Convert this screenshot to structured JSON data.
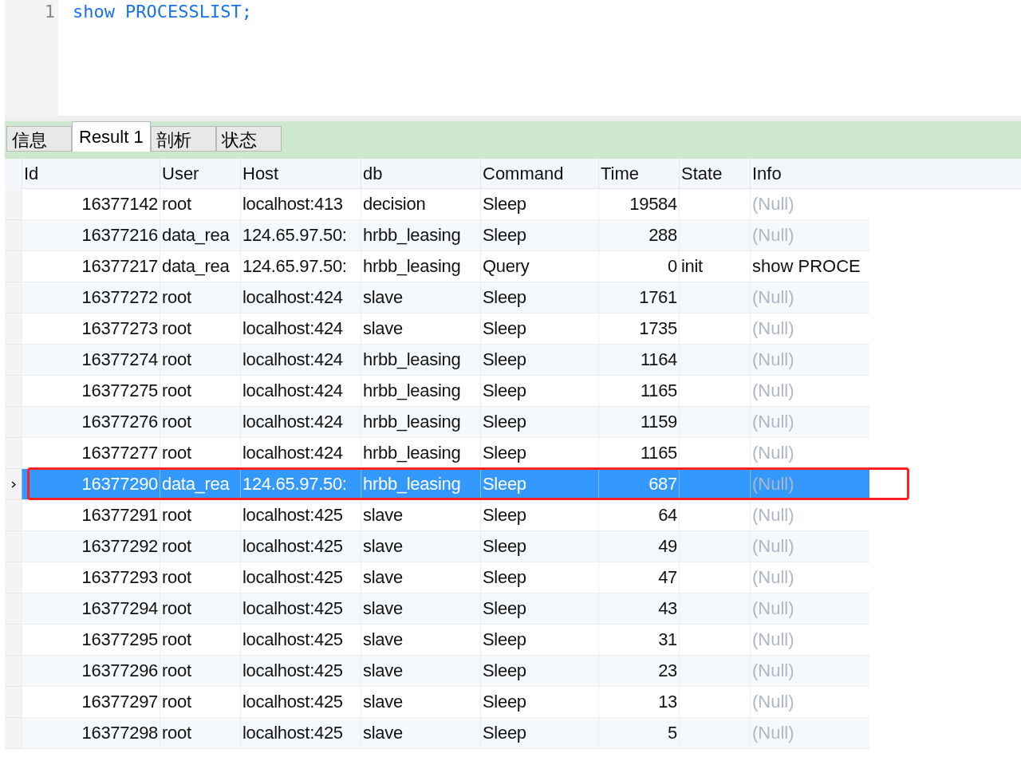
{
  "editor": {
    "lines": [
      {
        "number": "1",
        "keyword": "show",
        "rest": "PROCESSLIST;"
      }
    ]
  },
  "tabs": [
    {
      "label": "信息",
      "selected": false
    },
    {
      "label": "Result 1",
      "selected": true
    },
    {
      "label": "剖析",
      "selected": false
    },
    {
      "label": "状态",
      "selected": false
    }
  ],
  "table": {
    "columns": [
      "Id",
      "User",
      "Host",
      "db",
      "Command",
      "Time",
      "State",
      "Info"
    ],
    "rows": [
      {
        "cells": [
          "16377142",
          "root",
          "localhost:413",
          "decision",
          "Sleep",
          "19584",
          ""
        ],
        "info": "(Null)",
        "info_null": true,
        "selected": false,
        "highlighted": false
      },
      {
        "cells": [
          "16377216",
          "data_rea",
          "124.65.97.50:",
          "hrbb_leasing",
          "Sleep",
          "288",
          ""
        ],
        "info": "(Null)",
        "info_null": true,
        "selected": false,
        "highlighted": false
      },
      {
        "cells": [
          "16377217",
          "data_rea",
          "124.65.97.50:",
          "hrbb_leasing",
          "Query",
          "0",
          "init"
        ],
        "info": "show PROCE",
        "info_null": false,
        "selected": false,
        "highlighted": false
      },
      {
        "cells": [
          "16377272",
          "root",
          "localhost:424",
          "slave",
          "Sleep",
          "1761",
          ""
        ],
        "info": "(Null)",
        "info_null": true,
        "selected": false,
        "highlighted": false
      },
      {
        "cells": [
          "16377273",
          "root",
          "localhost:424",
          "slave",
          "Sleep",
          "1735",
          ""
        ],
        "info": "(Null)",
        "info_null": true,
        "selected": false,
        "highlighted": false
      },
      {
        "cells": [
          "16377274",
          "root",
          "localhost:424",
          "hrbb_leasing",
          "Sleep",
          "1164",
          ""
        ],
        "info": "(Null)",
        "info_null": true,
        "selected": false,
        "highlighted": false
      },
      {
        "cells": [
          "16377275",
          "root",
          "localhost:424",
          "hrbb_leasing",
          "Sleep",
          "1165",
          ""
        ],
        "info": "(Null)",
        "info_null": true,
        "selected": false,
        "highlighted": false
      },
      {
        "cells": [
          "16377276",
          "root",
          "localhost:424",
          "hrbb_leasing",
          "Sleep",
          "1159",
          ""
        ],
        "info": "(Null)",
        "info_null": true,
        "selected": false,
        "highlighted": false
      },
      {
        "cells": [
          "16377277",
          "root",
          "localhost:424",
          "hrbb_leasing",
          "Sleep",
          "1165",
          ""
        ],
        "info": "(Null)",
        "info_null": true,
        "selected": false,
        "highlighted": false
      },
      {
        "cells": [
          "16377290",
          "data_rea",
          "124.65.97.50:",
          "hrbb_leasing",
          "Sleep",
          "687",
          ""
        ],
        "info": "(Null)",
        "info_null": true,
        "selected": true,
        "highlighted": true
      },
      {
        "cells": [
          "16377291",
          "root",
          "localhost:425",
          "slave",
          "Sleep",
          "64",
          ""
        ],
        "info": "(Null)",
        "info_null": true,
        "selected": false,
        "highlighted": false
      },
      {
        "cells": [
          "16377292",
          "root",
          "localhost:425",
          "slave",
          "Sleep",
          "49",
          ""
        ],
        "info": "(Null)",
        "info_null": true,
        "selected": false,
        "highlighted": false
      },
      {
        "cells": [
          "16377293",
          "root",
          "localhost:425",
          "slave",
          "Sleep",
          "47",
          ""
        ],
        "info": "(Null)",
        "info_null": true,
        "selected": false,
        "highlighted": false
      },
      {
        "cells": [
          "16377294",
          "root",
          "localhost:425",
          "slave",
          "Sleep",
          "43",
          ""
        ],
        "info": "(Null)",
        "info_null": true,
        "selected": false,
        "highlighted": false
      },
      {
        "cells": [
          "16377295",
          "root",
          "localhost:425",
          "slave",
          "Sleep",
          "31",
          ""
        ],
        "info": "(Null)",
        "info_null": true,
        "selected": false,
        "highlighted": false
      },
      {
        "cells": [
          "16377296",
          "root",
          "localhost:425",
          "slave",
          "Sleep",
          "23",
          ""
        ],
        "info": "(Null)",
        "info_null": true,
        "selected": false,
        "highlighted": false
      },
      {
        "cells": [
          "16377297",
          "root",
          "localhost:425",
          "slave",
          "Sleep",
          "13",
          ""
        ],
        "info": "(Null)",
        "info_null": true,
        "selected": false,
        "highlighted": false
      },
      {
        "cells": [
          "16377298",
          "root",
          "localhost:425",
          "slave",
          "Sleep",
          "5",
          ""
        ],
        "info": "(Null)",
        "info_null": true,
        "selected": false,
        "highlighted": false
      }
    ]
  }
}
